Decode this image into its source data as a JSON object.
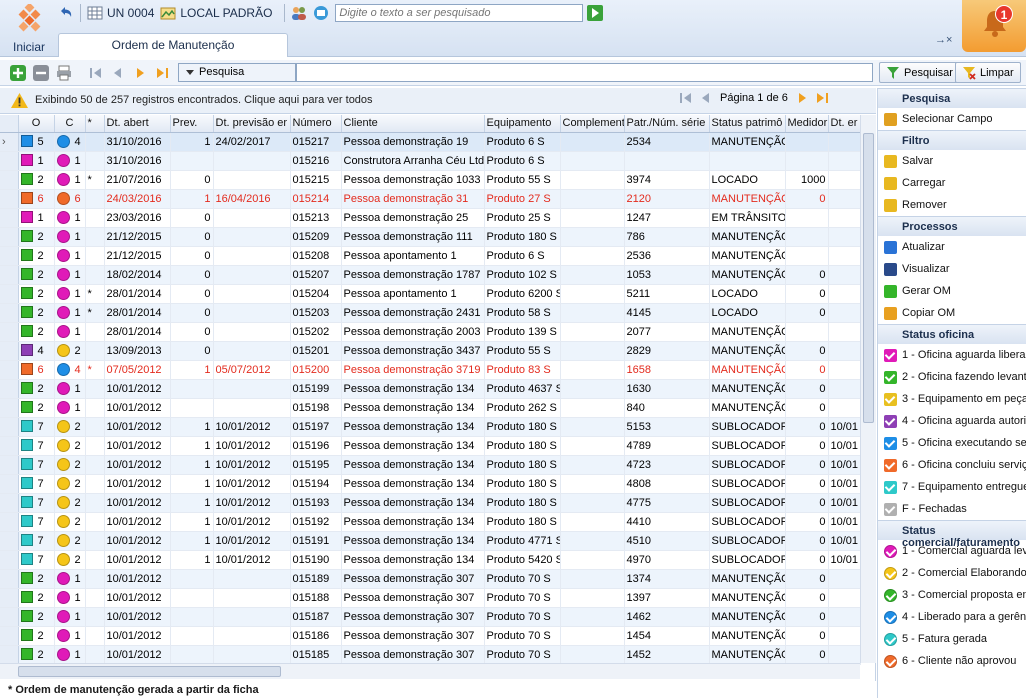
{
  "topbar": {
    "start_label": "Iniciar",
    "unit": "UN 0004",
    "location": "LOCAL PADRÃO",
    "search_placeholder": "Digite o texto a ser pesquisado",
    "tab_label": "Ordem de Manutenção",
    "notification_count": "1",
    "pin_close": "→×"
  },
  "toolbar": {
    "filter_label": "Pesquisa",
    "search_button": "Pesquisar",
    "clear_button": "Limpar"
  },
  "info": {
    "message": "Exibindo 50 de 257 registros encontrados. Clique aqui para ver todos",
    "page_label": "Página 1 de 6"
  },
  "columns": [
    "O",
    "C",
    "*",
    "Dt. abert",
    "Prev.",
    "Dt. previsão er",
    "Número",
    "Cliente",
    "Equipamento",
    "Complemento",
    "Patr./Núm. série",
    "Status patrimô",
    "Medidor",
    "Dt. er"
  ],
  "rows": [
    {
      "o": "5",
      "oc": "#1e8ee6",
      "c": "4",
      "cc": "#1e8ee6",
      "st": "",
      "dt": "31/10/2016",
      "prev": "1",
      "dtprev": "24/02/2017",
      "num": "015217",
      "cli": "Pessoa demonstração 19",
      "eq": "Produto 6 S",
      "comp": "",
      "patr": "2534",
      "status": "MANUTENÇÃO",
      "med": "",
      "dte": "",
      "red": false,
      "sel": true
    },
    {
      "o": "1",
      "oc": "#e01ab8",
      "c": "1",
      "cc": "#e01ab8",
      "st": "",
      "dt": "31/10/2016",
      "prev": "",
      "dtprev": "",
      "num": "015216",
      "cli": "Construtora Arranha Céu Ltda",
      "eq": "Produto 6 S",
      "comp": "",
      "patr": "",
      "status": "",
      "med": "",
      "dte": "",
      "red": false,
      "sel": false
    },
    {
      "o": "2",
      "oc": "#34b52a",
      "c": "1",
      "cc": "#e01ab8",
      "st": "*",
      "dt": "21/07/2016",
      "prev": "0",
      "dtprev": "",
      "num": "015215",
      "cli": "Pessoa demonstração 1033",
      "eq": "Produto 55 S",
      "comp": "",
      "patr": "3974",
      "status": "LOCADO",
      "med": "1000",
      "dte": "",
      "red": false,
      "sel": false
    },
    {
      "o": "6",
      "oc": "#f06a2a",
      "c": "6",
      "cc": "#f06a2a",
      "st": "",
      "dt": "24/03/2016",
      "prev": "1",
      "dtprev": "16/04/2016",
      "num": "015214",
      "cli": "Pessoa demonstração 31",
      "eq": "Produto 27 S",
      "comp": "",
      "patr": "2120",
      "status": "MANUTENÇÃO",
      "med": "0",
      "dte": "",
      "red": true,
      "sel": false
    },
    {
      "o": "1",
      "oc": "#e01ab8",
      "c": "1",
      "cc": "#e01ab8",
      "st": "",
      "dt": "23/03/2016",
      "prev": "0",
      "dtprev": "",
      "num": "015213",
      "cli": "Pessoa demonstração 25",
      "eq": "Produto 25 S",
      "comp": "",
      "patr": "1247",
      "status": "EM TRÂNSITO",
      "med": "",
      "dte": "",
      "red": false,
      "sel": false
    },
    {
      "o": "2",
      "oc": "#34b52a",
      "c": "1",
      "cc": "#e01ab8",
      "st": "",
      "dt": "21/12/2015",
      "prev": "0",
      "dtprev": "",
      "num": "015209",
      "cli": "Pessoa demonstração 111",
      "eq": "Produto 180 S",
      "comp": "",
      "patr": "786",
      "status": "MANUTENÇÃO",
      "med": "",
      "dte": "",
      "red": false,
      "sel": false
    },
    {
      "o": "2",
      "oc": "#34b52a",
      "c": "1",
      "cc": "#e01ab8",
      "st": "",
      "dt": "21/12/2015",
      "prev": "0",
      "dtprev": "",
      "num": "015208",
      "cli": "Pessoa apontamento 1",
      "eq": "Produto 6 S",
      "comp": "",
      "patr": "2536",
      "status": "MANUTENÇÃO",
      "med": "",
      "dte": "",
      "red": false,
      "sel": false
    },
    {
      "o": "2",
      "oc": "#34b52a",
      "c": "1",
      "cc": "#e01ab8",
      "st": "",
      "dt": "18/02/2014",
      "prev": "0",
      "dtprev": "",
      "num": "015207",
      "cli": "Pessoa demonstração 1787",
      "eq": "Produto 102 S",
      "comp": "",
      "patr": "1053",
      "status": "MANUTENÇÃO",
      "med": "0",
      "dte": "",
      "red": false,
      "sel": false
    },
    {
      "o": "2",
      "oc": "#34b52a",
      "c": "1",
      "cc": "#e01ab8",
      "st": "*",
      "dt": "28/01/2014",
      "prev": "0",
      "dtprev": "",
      "num": "015204",
      "cli": "Pessoa apontamento 1",
      "eq": "Produto 6200 S",
      "comp": "",
      "patr": "5211",
      "status": "LOCADO",
      "med": "0",
      "dte": "",
      "red": false,
      "sel": false
    },
    {
      "o": "2",
      "oc": "#34b52a",
      "c": "1",
      "cc": "#e01ab8",
      "st": "*",
      "dt": "28/01/2014",
      "prev": "0",
      "dtprev": "",
      "num": "015203",
      "cli": "Pessoa demonstração 2431",
      "eq": "Produto 58 S",
      "comp": "",
      "patr": "4145",
      "status": "LOCADO",
      "med": "0",
      "dte": "",
      "red": false,
      "sel": false
    },
    {
      "o": "2",
      "oc": "#34b52a",
      "c": "1",
      "cc": "#e01ab8",
      "st": "",
      "dt": "28/01/2014",
      "prev": "0",
      "dtprev": "",
      "num": "015202",
      "cli": "Pessoa demonstração 2003",
      "eq": "Produto 139 S",
      "comp": "",
      "patr": "2077",
      "status": "MANUTENÇÃO",
      "med": "",
      "dte": "",
      "red": false,
      "sel": false
    },
    {
      "o": "4",
      "oc": "#8e3fb5",
      "c": "2",
      "cc": "#f5c518",
      "st": "",
      "dt": "13/09/2013",
      "prev": "0",
      "dtprev": "",
      "num": "015201",
      "cli": "Pessoa demonstração 3437",
      "eq": "Produto 55 S",
      "comp": "",
      "patr": "2829",
      "status": "MANUTENÇÃO",
      "med": "0",
      "dte": "",
      "red": false,
      "sel": false
    },
    {
      "o": "6",
      "oc": "#f06a2a",
      "c": "4",
      "cc": "#1e8ee6",
      "st": "*",
      "dt": "07/05/2012",
      "prev": "1",
      "dtprev": "05/07/2012",
      "num": "015200",
      "cli": "Pessoa demonstração 3719",
      "eq": "Produto 83 S",
      "comp": "",
      "patr": "1658",
      "status": "MANUTENÇÃO",
      "med": "0",
      "dte": "",
      "red": true,
      "sel": false
    },
    {
      "o": "2",
      "oc": "#34b52a",
      "c": "1",
      "cc": "#e01ab8",
      "st": "",
      "dt": "10/01/2012",
      "prev": "",
      "dtprev": "",
      "num": "015199",
      "cli": "Pessoa demonstração 134",
      "eq": "Produto 4637 S",
      "comp": "",
      "patr": "1630",
      "status": "MANUTENÇÃO",
      "med": "0",
      "dte": "",
      "red": false,
      "sel": false
    },
    {
      "o": "2",
      "oc": "#34b52a",
      "c": "1",
      "cc": "#e01ab8",
      "st": "",
      "dt": "10/01/2012",
      "prev": "",
      "dtprev": "",
      "num": "015198",
      "cli": "Pessoa demonstração 134",
      "eq": "Produto 262 S",
      "comp": "",
      "patr": "840",
      "status": "MANUTENÇÃO",
      "med": "0",
      "dte": "",
      "red": false,
      "sel": false
    },
    {
      "o": "7",
      "oc": "#2ec9c9",
      "c": "2",
      "cc": "#f5c518",
      "st": "",
      "dt": "10/01/2012",
      "prev": "1",
      "dtprev": "10/01/2012",
      "num": "015197",
      "cli": "Pessoa demonstração 134",
      "eq": "Produto 180 S",
      "comp": "",
      "patr": "5153",
      "status": "SUBLOCADORA",
      "med": "0",
      "dte": "10/01",
      "red": false,
      "sel": false
    },
    {
      "o": "7",
      "oc": "#2ec9c9",
      "c": "2",
      "cc": "#f5c518",
      "st": "",
      "dt": "10/01/2012",
      "prev": "1",
      "dtprev": "10/01/2012",
      "num": "015196",
      "cli": "Pessoa demonstração 134",
      "eq": "Produto 180 S",
      "comp": "",
      "patr": "4789",
      "status": "SUBLOCADORA",
      "med": "0",
      "dte": "10/01",
      "red": false,
      "sel": false
    },
    {
      "o": "7",
      "oc": "#2ec9c9",
      "c": "2",
      "cc": "#f5c518",
      "st": "",
      "dt": "10/01/2012",
      "prev": "1",
      "dtprev": "10/01/2012",
      "num": "015195",
      "cli": "Pessoa demonstração 134",
      "eq": "Produto 180 S",
      "comp": "",
      "patr": "4723",
      "status": "SUBLOCADORA",
      "med": "0",
      "dte": "10/01",
      "red": false,
      "sel": false
    },
    {
      "o": "7",
      "oc": "#2ec9c9",
      "c": "2",
      "cc": "#f5c518",
      "st": "",
      "dt": "10/01/2012",
      "prev": "1",
      "dtprev": "10/01/2012",
      "num": "015194",
      "cli": "Pessoa demonstração 134",
      "eq": "Produto 180 S",
      "comp": "",
      "patr": "4808",
      "status": "SUBLOCADORA",
      "med": "0",
      "dte": "10/01",
      "red": false,
      "sel": false
    },
    {
      "o": "7",
      "oc": "#2ec9c9",
      "c": "2",
      "cc": "#f5c518",
      "st": "",
      "dt": "10/01/2012",
      "prev": "1",
      "dtprev": "10/01/2012",
      "num": "015193",
      "cli": "Pessoa demonstração 134",
      "eq": "Produto 180 S",
      "comp": "",
      "patr": "4775",
      "status": "SUBLOCADORA",
      "med": "0",
      "dte": "10/01",
      "red": false,
      "sel": false
    },
    {
      "o": "7",
      "oc": "#2ec9c9",
      "c": "2",
      "cc": "#f5c518",
      "st": "",
      "dt": "10/01/2012",
      "prev": "1",
      "dtprev": "10/01/2012",
      "num": "015192",
      "cli": "Pessoa demonstração 134",
      "eq": "Produto 180 S",
      "comp": "",
      "patr": "4410",
      "status": "SUBLOCADORA",
      "med": "0",
      "dte": "10/01",
      "red": false,
      "sel": false
    },
    {
      "o": "7",
      "oc": "#2ec9c9",
      "c": "2",
      "cc": "#f5c518",
      "st": "",
      "dt": "10/01/2012",
      "prev": "1",
      "dtprev": "10/01/2012",
      "num": "015191",
      "cli": "Pessoa demonstração 134",
      "eq": "Produto 4771 S",
      "comp": "",
      "patr": "4510",
      "status": "SUBLOCADORA",
      "med": "0",
      "dte": "10/01",
      "red": false,
      "sel": false
    },
    {
      "o": "7",
      "oc": "#2ec9c9",
      "c": "2",
      "cc": "#f5c518",
      "st": "",
      "dt": "10/01/2012",
      "prev": "1",
      "dtprev": "10/01/2012",
      "num": "015190",
      "cli": "Pessoa demonstração 134",
      "eq": "Produto 5420 S",
      "comp": "",
      "patr": "4970",
      "status": "SUBLOCADORA",
      "med": "0",
      "dte": "10/01",
      "red": false,
      "sel": false
    },
    {
      "o": "2",
      "oc": "#34b52a",
      "c": "1",
      "cc": "#e01ab8",
      "st": "",
      "dt": "10/01/2012",
      "prev": "",
      "dtprev": "",
      "num": "015189",
      "cli": "Pessoa demonstração 307",
      "eq": "Produto 70 S",
      "comp": "",
      "patr": "1374",
      "status": "MANUTENÇÃO",
      "med": "0",
      "dte": "",
      "red": false,
      "sel": false
    },
    {
      "o": "2",
      "oc": "#34b52a",
      "c": "1",
      "cc": "#e01ab8",
      "st": "",
      "dt": "10/01/2012",
      "prev": "",
      "dtprev": "",
      "num": "015188",
      "cli": "Pessoa demonstração 307",
      "eq": "Produto 70 S",
      "comp": "",
      "patr": "1397",
      "status": "MANUTENÇÃO",
      "med": "0",
      "dte": "",
      "red": false,
      "sel": false
    },
    {
      "o": "2",
      "oc": "#34b52a",
      "c": "1",
      "cc": "#e01ab8",
      "st": "",
      "dt": "10/01/2012",
      "prev": "",
      "dtprev": "",
      "num": "015187",
      "cli": "Pessoa demonstração 307",
      "eq": "Produto 70 S",
      "comp": "",
      "patr": "1462",
      "status": "MANUTENÇÃO",
      "med": "0",
      "dte": "",
      "red": false,
      "sel": false
    },
    {
      "o": "2",
      "oc": "#34b52a",
      "c": "1",
      "cc": "#e01ab8",
      "st": "",
      "dt": "10/01/2012",
      "prev": "",
      "dtprev": "",
      "num": "015186",
      "cli": "Pessoa demonstração 307",
      "eq": "Produto 70 S",
      "comp": "",
      "patr": "1454",
      "status": "MANUTENÇÃO",
      "med": "0",
      "dte": "",
      "red": false,
      "sel": false
    },
    {
      "o": "2",
      "oc": "#34b52a",
      "c": "1",
      "cc": "#e01ab8",
      "st": "",
      "dt": "10/01/2012",
      "prev": "",
      "dtprev": "",
      "num": "015185",
      "cli": "Pessoa demonstração 307",
      "eq": "Produto 70 S",
      "comp": "",
      "patr": "1452",
      "status": "MANUTENÇÃO",
      "med": "0",
      "dte": "",
      "red": false,
      "sel": false
    }
  ],
  "footnote": "* Ordem de manutenção gerada a partir da ficha",
  "panel": {
    "sections": [
      {
        "title": "Pesquisa",
        "items": [
          {
            "label": "Selecionar Campo",
            "icon": "select-field-icon",
            "kind": "icon",
            "color": "#e0a020"
          }
        ]
      },
      {
        "title": "Filtro",
        "items": [
          {
            "label": "Salvar",
            "icon": "filter-save-icon",
            "kind": "icon",
            "color": "#e8b820"
          },
          {
            "label": "Carregar",
            "icon": "filter-load-icon",
            "kind": "icon",
            "color": "#e8b820"
          },
          {
            "label": "Remover",
            "icon": "filter-remove-icon",
            "kind": "icon",
            "color": "#e8b820"
          }
        ]
      },
      {
        "title": "Processos",
        "items": [
          {
            "label": "Atualizar",
            "icon": "refresh-icon",
            "kind": "icon",
            "color": "#2a73d6"
          },
          {
            "label": "Visualizar",
            "icon": "view-icon",
            "kind": "icon",
            "color": "#2a4a8a"
          },
          {
            "label": "Gerar OM",
            "icon": "generate-order-icon",
            "kind": "icon",
            "color": "#34b52a"
          },
          {
            "label": "Copiar OM",
            "icon": "copy-order-icon",
            "kind": "icon",
            "color": "#e8a020"
          }
        ]
      },
      {
        "title": "Status oficina",
        "items": [
          {
            "label": "1 - Oficina aguarda liberação",
            "icon": "check-icon",
            "kind": "check",
            "color": "#e01ab8"
          },
          {
            "label": "2 - Oficina fazendo levantamento",
            "icon": "check-icon",
            "kind": "check",
            "color": "#34b52a"
          },
          {
            "label": "3 - Equipamento em peças",
            "icon": "check-icon",
            "kind": "check",
            "color": "#e8c020"
          },
          {
            "label": "4 - Oficina aguarda autorização",
            "icon": "check-icon",
            "kind": "check",
            "color": "#8e3fb5"
          },
          {
            "label": "5 - Oficina executando serviço",
            "icon": "check-icon",
            "kind": "check",
            "color": "#1e8ee6"
          },
          {
            "label": "6 - Oficina concluiu serviço",
            "icon": "check-icon",
            "kind": "check",
            "color": "#f06a2a"
          },
          {
            "label": "7 - Equipamento entregue",
            "icon": "check-icon",
            "kind": "check",
            "color": "#2ec9c9"
          },
          {
            "label": "F - Fechadas",
            "icon": "check-icon",
            "kind": "check",
            "color": "#b0b0b0"
          }
        ]
      },
      {
        "title": "Status comercial/faturamento",
        "items": [
          {
            "label": "1 - Comercial aguarda levantamento",
            "icon": "check-circle-icon",
            "kind": "dot",
            "color": "#e01ab8"
          },
          {
            "label": "2 - Comercial Elaborando orçamento",
            "icon": "check-circle-icon",
            "kind": "dot",
            "color": "#f5c518"
          },
          {
            "label": "3 - Comercial proposta enviada",
            "icon": "check-circle-icon",
            "kind": "dot",
            "color": "#34b52a"
          },
          {
            "label": "4 - Liberado para a gerência",
            "icon": "check-circle-icon",
            "kind": "dot",
            "color": "#1e8ee6"
          },
          {
            "label": "5 - Fatura gerada",
            "icon": "check-circle-icon",
            "kind": "dot",
            "color": "#2ec9c9"
          },
          {
            "label": "6 - Cliente não aprovou",
            "icon": "check-circle-icon",
            "kind": "dot",
            "color": "#f06a2a"
          }
        ]
      }
    ]
  }
}
